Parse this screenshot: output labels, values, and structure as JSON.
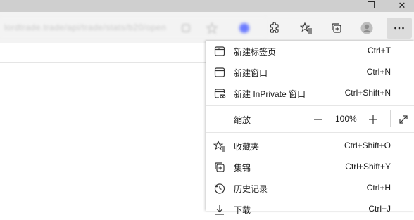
{
  "window": {
    "minimize_glyph": "—",
    "restore_glyph": "❐",
    "close_glyph": "✕"
  },
  "toolbar": {
    "address_text": "lordtrade.trade/api/trade/stats/b20/open"
  },
  "menu": {
    "new_tab": {
      "label": "新建标签页",
      "shortcut": "Ctrl+T"
    },
    "new_window": {
      "label": "新建窗口",
      "shortcut": "Ctrl+N"
    },
    "new_inprivate": {
      "label": "新建 InPrivate 窗口",
      "shortcut": "Ctrl+Shift+N"
    },
    "zoom": {
      "label": "缩放",
      "value": "100%"
    },
    "favorites": {
      "label": "收藏夹",
      "shortcut": "Ctrl+Shift+O"
    },
    "collections": {
      "label": "集锦",
      "shortcut": "Ctrl+Shift+Y"
    },
    "history": {
      "label": "历史记录",
      "shortcut": "Ctrl+H"
    },
    "downloads": {
      "label": "下载",
      "shortcut": "Ctrl+J"
    }
  },
  "colors": {
    "accent_blur": "#6b7bff",
    "titlebar": "#cfcfcf",
    "toolbar": "#f3f3f3"
  }
}
